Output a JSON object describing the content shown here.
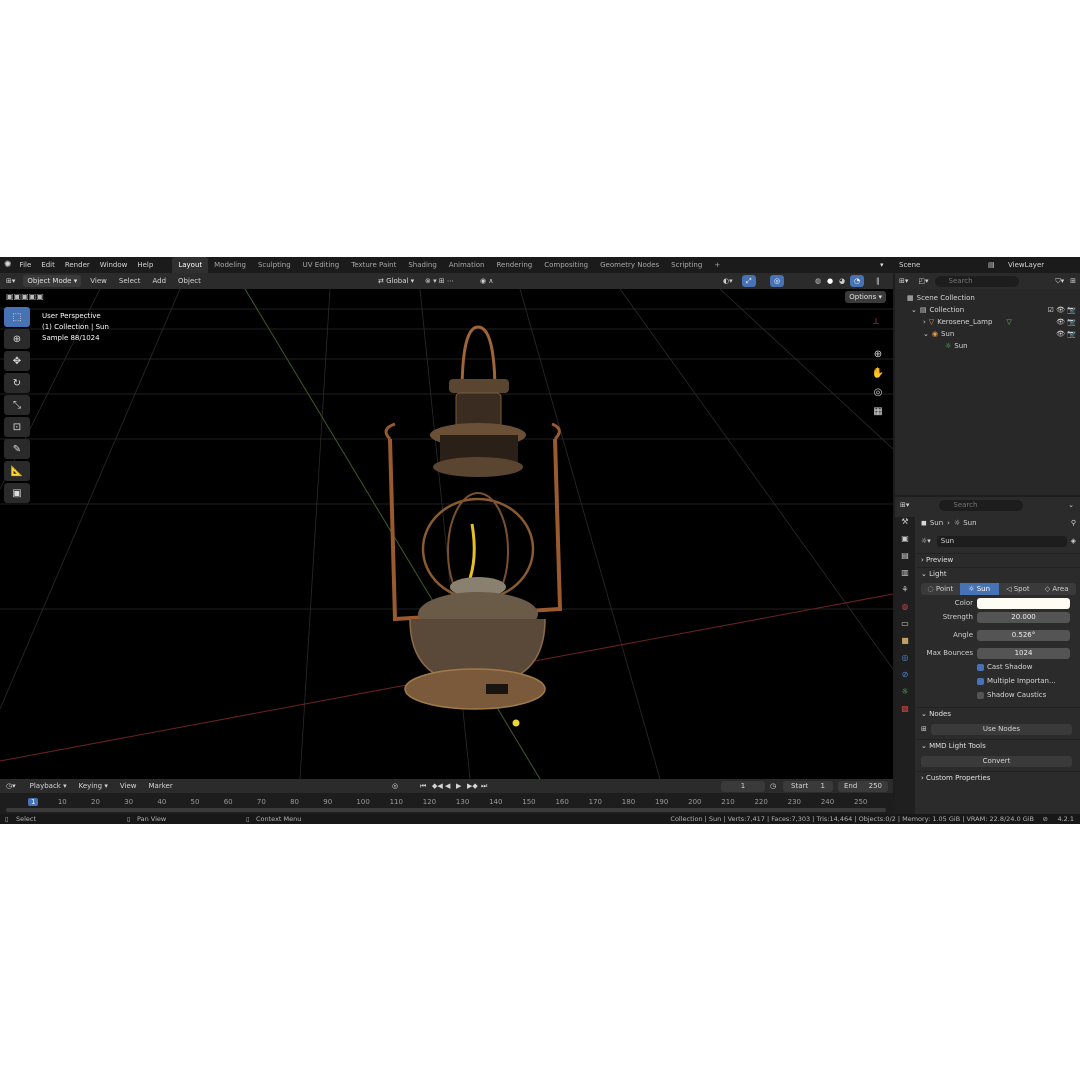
{
  "menubar": {
    "menus": [
      "File",
      "Edit",
      "Render",
      "Window",
      "Help"
    ],
    "workspaces": [
      "Layout",
      "Modeling",
      "Sculpting",
      "UV Editing",
      "Texture Paint",
      "Shading",
      "Animation",
      "Rendering",
      "Compositing",
      "Geometry Nodes",
      "Scripting"
    ],
    "scene": "Scene",
    "view_layer": "ViewLayer"
  },
  "viewport_header": {
    "mode": "Object Mode",
    "menus": [
      "View",
      "Select",
      "Add",
      "Object"
    ],
    "transform": "Global",
    "options": "Options"
  },
  "hud": {
    "line1": "User Perspective",
    "line2": "(1) Collection | Sun",
    "line3": "Sample 88/1024"
  },
  "outliner": {
    "search_placeholder": "Search",
    "rows": [
      "Scene Collection",
      "Collection",
      "Kerosene_Lamp",
      "Sun",
      "Sun"
    ]
  },
  "properties": {
    "search_placeholder": "Search",
    "breadcrumb": [
      "Sun",
      "Sun"
    ],
    "datablock": "Sun",
    "sections": {
      "preview": "Preview",
      "light": "Light",
      "nodes": "Nodes",
      "mmd": "MMD Light Tools",
      "custom": "Custom Properties"
    },
    "light_types": [
      "Point",
      "Sun",
      "Spot",
      "Area"
    ],
    "color_label": "Color",
    "strength_label": "Strength",
    "strength": "20.000",
    "angle_label": "Angle",
    "angle": "0.526°",
    "bounces_label": "Max Bounces",
    "bounces": "1024",
    "cast_shadow": "Cast Shadow",
    "multiple_importance": "Multiple Importan...",
    "shadow_caustics": "Shadow Caustics",
    "use_nodes": "Use Nodes",
    "convert": "Convert"
  },
  "timeline": {
    "menus": [
      "Playback",
      "Keying",
      "View",
      "Marker"
    ],
    "current_frame": "1",
    "start_label": "Start",
    "start": "1",
    "end_label": "End",
    "end": "250",
    "ticks": [
      "1",
      "10",
      "20",
      "30",
      "40",
      "50",
      "60",
      "70",
      "80",
      "90",
      "100",
      "110",
      "120",
      "130",
      "140",
      "150",
      "160",
      "170",
      "180",
      "190",
      "200",
      "210",
      "220",
      "230",
      "240",
      "250"
    ]
  },
  "status": {
    "select": "Select",
    "pan": "Pan View",
    "context": "Context Menu",
    "stats": "Collection | Sun | Verts:7,417 | Faces:7,303 | Tris:14,464 | Objects:0/2 | Memory: 1.05 GiB | VRAM: 22.8/24.0 GiB",
    "version": "4.2.1"
  },
  "colors": {
    "accent": "#4772b3",
    "panel": "#2b2b2b",
    "viewport_bg": "#000000"
  }
}
